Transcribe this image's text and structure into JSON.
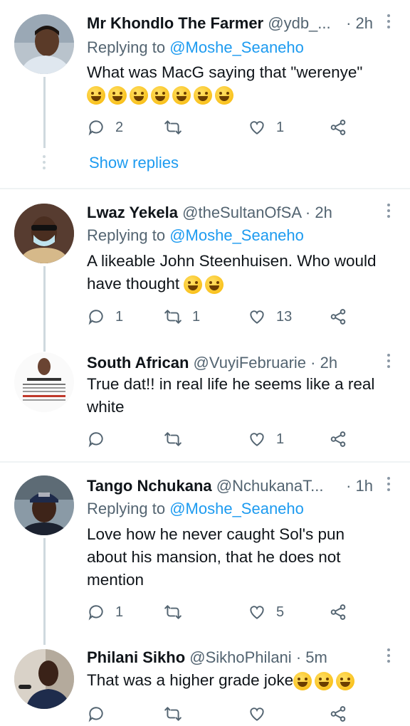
{
  "tweets": [
    {
      "name": "Mr Khondlo The Farmer",
      "handle": "@ydb_...",
      "time": "· 2h",
      "replying_prefix": "Replying to",
      "replying_to": "@Moshe_Seaneho",
      "text": "What was MacG saying that \"werenye\"",
      "emoji": "rofl x7",
      "replies": "2",
      "retweets": "",
      "likes": "1",
      "show_replies": "Show replies"
    },
    {
      "name": "Lwaz Yekela",
      "handle": "@theSultanOfSA",
      "time": "· 2h",
      "replying_prefix": "Replying to",
      "replying_to": "@Moshe_Seaneho",
      "text": "A likeable John Steenhuisen. Who would have thought",
      "replies": "1",
      "retweets": "1",
      "likes": "13"
    },
    {
      "name": "South African",
      "handle": "@VuyiFebruarie",
      "time": "· 2h",
      "text": "True dat!! in real life he seems like a real white",
      "replies": "",
      "retweets": "",
      "likes": "1"
    },
    {
      "name": "Tango Nchukana",
      "handle": "@NchukanaT...",
      "time": "· 1h",
      "replying_prefix": "Replying to",
      "replying_to": "@Moshe_Seaneho",
      "text": "Love how he never caught Sol's pun about his mansion, that he does not mention",
      "replies": "1",
      "retweets": "",
      "likes": "5"
    },
    {
      "name": "Philani Sikho",
      "handle": "@SikhoPhilani",
      "time": "· 5m",
      "text": "That was a higher grade joke"
    }
  ]
}
